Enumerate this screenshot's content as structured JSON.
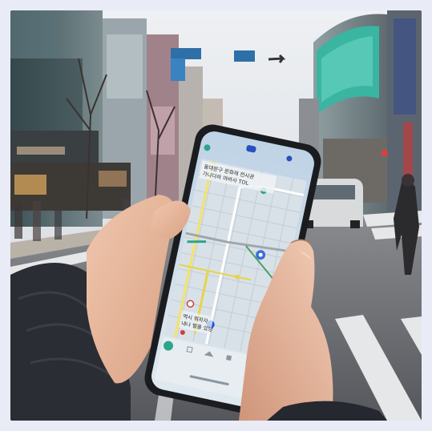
{
  "photo": {
    "subject": "hand holding smartphone with map app on city street",
    "phone_screen": {
      "header_text_line1": "동대문구 문화재 전시관",
      "header_text_line2": "가나다라 마바사 TOL",
      "bottom_label_line1": "역시 뭐하자",
      "bottom_label_line2": "내나 벌을 있당",
      "nav_icons": [
        "phone-icon",
        "grid-icon",
        "home-icon",
        "lock-icon",
        "bag-icon"
      ]
    },
    "colors": {
      "background_border": "#e9ebf7",
      "sky": "#e8ebef",
      "road": "#6f7176",
      "crosswalk": "#e6e7e8",
      "sweater": "#2a2d33",
      "skin": "#e6b89c",
      "phone_body": "#1b1c20",
      "map_road_yellow": "#e6d44a",
      "map_accent_blue": "#3b6fd8"
    }
  }
}
